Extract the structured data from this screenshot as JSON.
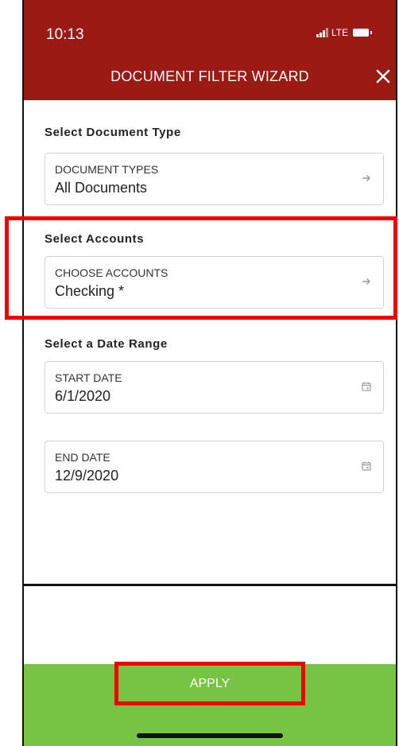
{
  "status_bar": {
    "time": "10:13",
    "network": "LTE"
  },
  "header": {
    "title": "DOCUMENT FILTER WIZARD",
    "close_icon": "close-icon"
  },
  "sections": {
    "document_type": {
      "label": "Select Document Type",
      "caption": "DOCUMENT TYPES",
      "value": "All Documents",
      "icon": "arrow-right-icon"
    },
    "accounts": {
      "label": "Select Accounts",
      "caption": "CHOOSE ACCOUNTS",
      "value": "Checking *",
      "icon": "arrow-right-icon"
    },
    "date_range": {
      "label": "Select a Date Range",
      "start": {
        "caption": "START DATE",
        "value": "6/1/2020",
        "icon": "calendar-icon"
      },
      "end": {
        "caption": "END DATE",
        "value": "12/9/2020",
        "icon": "calendar-icon"
      }
    }
  },
  "footer": {
    "apply_label": "APPLY"
  },
  "colors": {
    "header_bg": "#9b1b14",
    "footer_bg": "#76c443",
    "highlight": "#f20000"
  }
}
